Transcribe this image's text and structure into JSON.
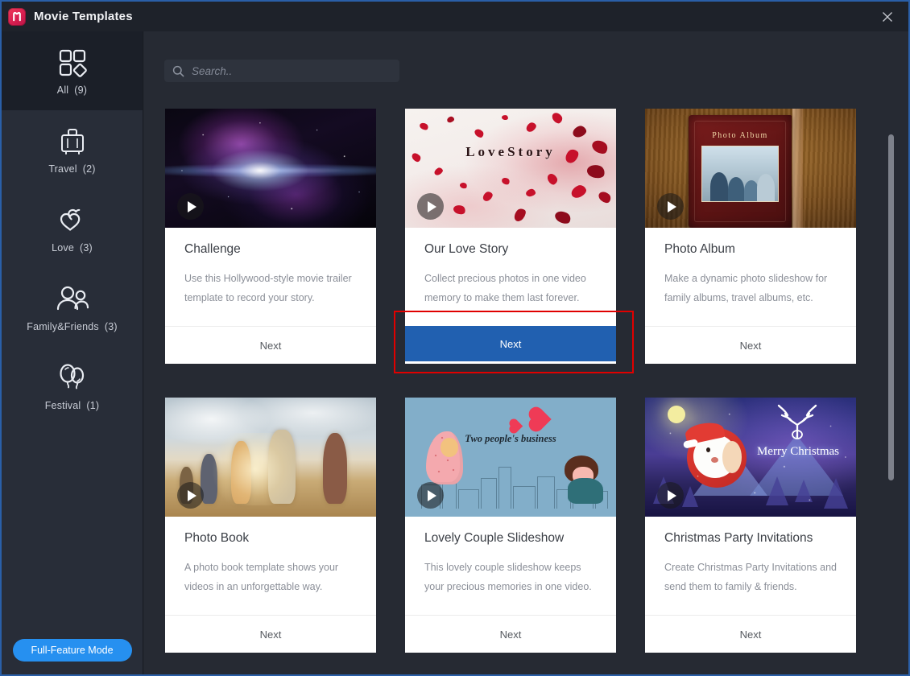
{
  "window": {
    "title": "Movie Templates",
    "logo_icon": "movie-maker-logo",
    "close_icon": "close-icon"
  },
  "sidebar": {
    "items": [
      {
        "label": "All",
        "count": "(9)",
        "icon": "grid-icon",
        "selected": true
      },
      {
        "label": "Travel",
        "count": "(2)",
        "icon": "suitcase-icon",
        "selected": false
      },
      {
        "label": "Love",
        "count": "(3)",
        "icon": "hearts-icon",
        "selected": false
      },
      {
        "label": "Family&Friends",
        "count": "(3)",
        "icon": "people-icon",
        "selected": false
      },
      {
        "label": "Festival",
        "count": "(1)",
        "icon": "balloons-icon",
        "selected": false
      }
    ],
    "full_feature_button": "Full-Feature Mode"
  },
  "search": {
    "placeholder": "Search..",
    "value": "",
    "icon": "search-icon"
  },
  "templates": [
    {
      "title": "Challenge",
      "description": "Use this Hollywood-style movie trailer template to record your story.",
      "next_label": "Next",
      "thumbnail": "space-nebula-lens-flare",
      "play_icon": "play-icon",
      "highlighted": false
    },
    {
      "title": "Our Love Story",
      "description": "Collect precious photos in one video memory to make them last forever.",
      "next_label": "Next",
      "thumbnail": "red-rose-petals",
      "thumbnail_text": "LoveStory",
      "play_icon": "play-icon",
      "highlighted": true
    },
    {
      "title": "Photo Album",
      "description": "Make a dynamic photo slideshow for family albums, travel albums, etc.",
      "next_label": "Next",
      "thumbnail": "leather-photo-album-book",
      "thumbnail_text": "Photo Album",
      "play_icon": "play-icon",
      "highlighted": false
    },
    {
      "title": "Photo Book",
      "description": "A photo book template shows your videos in an unforgettable way.",
      "next_label": "Next",
      "thumbnail": "beach-runners-sunset",
      "play_icon": "play-icon",
      "highlighted": false
    },
    {
      "title": "Lovely Couple Slideshow",
      "description": "This lovely couple slideshow keeps your precious memories in one video.",
      "next_label": "Next",
      "thumbnail": "cartoon-couple-city-skyline",
      "thumbnail_text": "Two people's business",
      "play_icon": "play-icon",
      "highlighted": false
    },
    {
      "title": "Christmas Party Invitations",
      "description": "Create Christmas Party Invitations and send them to family & friends.",
      "next_label": "Next",
      "thumbnail": "santa-winter-night-reindeer",
      "thumbnail_text": "Merry Christmas",
      "play_icon": "play-icon",
      "highlighted": false
    }
  ],
  "annotation": {
    "type": "red-highlight-box",
    "color": "#e00000",
    "target": "Our Love Story Next button"
  },
  "colors": {
    "accent_blue": "#2160b0",
    "button_blue": "#2690f0",
    "sidebar_bg": "#282d38",
    "main_bg": "#262a33",
    "titlebar_bg": "#1e222a",
    "annotation_red": "#e00000"
  },
  "scrollbar": {
    "orientation": "vertical",
    "thumb_color": "#7d818b"
  }
}
